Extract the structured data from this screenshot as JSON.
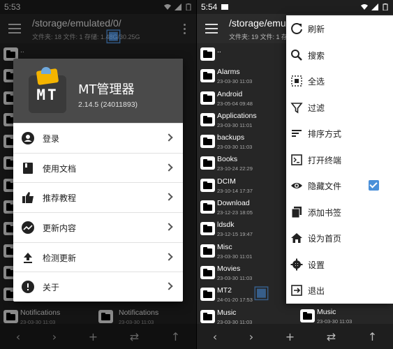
{
  "left": {
    "status_time": "5:53",
    "path": "/storage/emulated/0/",
    "path_stats": "文件夹: 18  文件: 1  存储: 1.48G/30.25G",
    "files_col1": [
      {
        "name": "..",
        "date": ""
      },
      {
        "name": "",
        "date": ""
      }
    ],
    "bottom_file": {
      "name": "Notifications",
      "date": "23-03-30 11:03"
    },
    "bottom_file2": {
      "name": "Notifications",
      "date": "23-03-30 11:03"
    },
    "dialog": {
      "app_name": "MT管理器",
      "version": "2.14.5 (24011893)",
      "logo_text": "MT",
      "items": [
        {
          "label": "登录",
          "icon": "account-icon"
        },
        {
          "label": "使用文档",
          "icon": "book-icon"
        },
        {
          "label": "推荐教程",
          "icon": "thumb-up-icon"
        },
        {
          "label": "更新内容",
          "icon": "trending-icon"
        },
        {
          "label": "检测更新",
          "icon": "upload-icon"
        },
        {
          "label": "关于",
          "icon": "info-icon"
        }
      ]
    }
  },
  "right": {
    "status_time": "5:54",
    "path": "/storage/emu",
    "path_stats": "文件夹: 19  文件: 1  存",
    "files": [
      {
        "name": "..",
        "date": ""
      },
      {
        "name": "Alarms",
        "date": "23-03-30 11:03"
      },
      {
        "name": "Android",
        "date": "23-05-04 09:48"
      },
      {
        "name": "Applications",
        "date": "23-03-30 11:01"
      },
      {
        "name": "backups",
        "date": "23-03-30 11:03"
      },
      {
        "name": "Books",
        "date": "23-10-24 22:29"
      },
      {
        "name": "DCIM",
        "date": "23-10-14 17:37"
      },
      {
        "name": "Download",
        "date": "23-12-23 18:05"
      },
      {
        "name": "ldsdk",
        "date": "23-12-15 19:47"
      },
      {
        "name": "Misc",
        "date": "23-03-30 11:01"
      },
      {
        "name": "Movies",
        "date": "23-03-30 11:03"
      },
      {
        "name": "MT2",
        "date": "24-01-20 17:53"
      },
      {
        "name": "Music",
        "date": "23-03-30 11:03"
      }
    ],
    "second_music": {
      "name": "Music",
      "date": "23-03-30 11:03"
    },
    "menu": [
      {
        "label": "刷新",
        "icon": "refresh-icon"
      },
      {
        "label": "搜索",
        "icon": "search-icon"
      },
      {
        "label": "全选",
        "icon": "select-all-icon"
      },
      {
        "label": "过滤",
        "icon": "filter-icon"
      },
      {
        "label": "排序方式",
        "icon": "sort-icon"
      },
      {
        "label": "打开终端",
        "icon": "terminal-icon"
      },
      {
        "label": "隐藏文件",
        "icon": "eye-icon",
        "checked": true
      },
      {
        "label": "添加书签",
        "icon": "bookmark-icon"
      },
      {
        "label": "设为首页",
        "icon": "home-icon"
      },
      {
        "label": "设置",
        "icon": "settings-icon"
      },
      {
        "label": "退出",
        "icon": "exit-icon"
      }
    ]
  },
  "colors": {
    "accent": "#4a90d9",
    "dialog_header": "#4a4a4a",
    "logo_tag": "#f4b400"
  }
}
